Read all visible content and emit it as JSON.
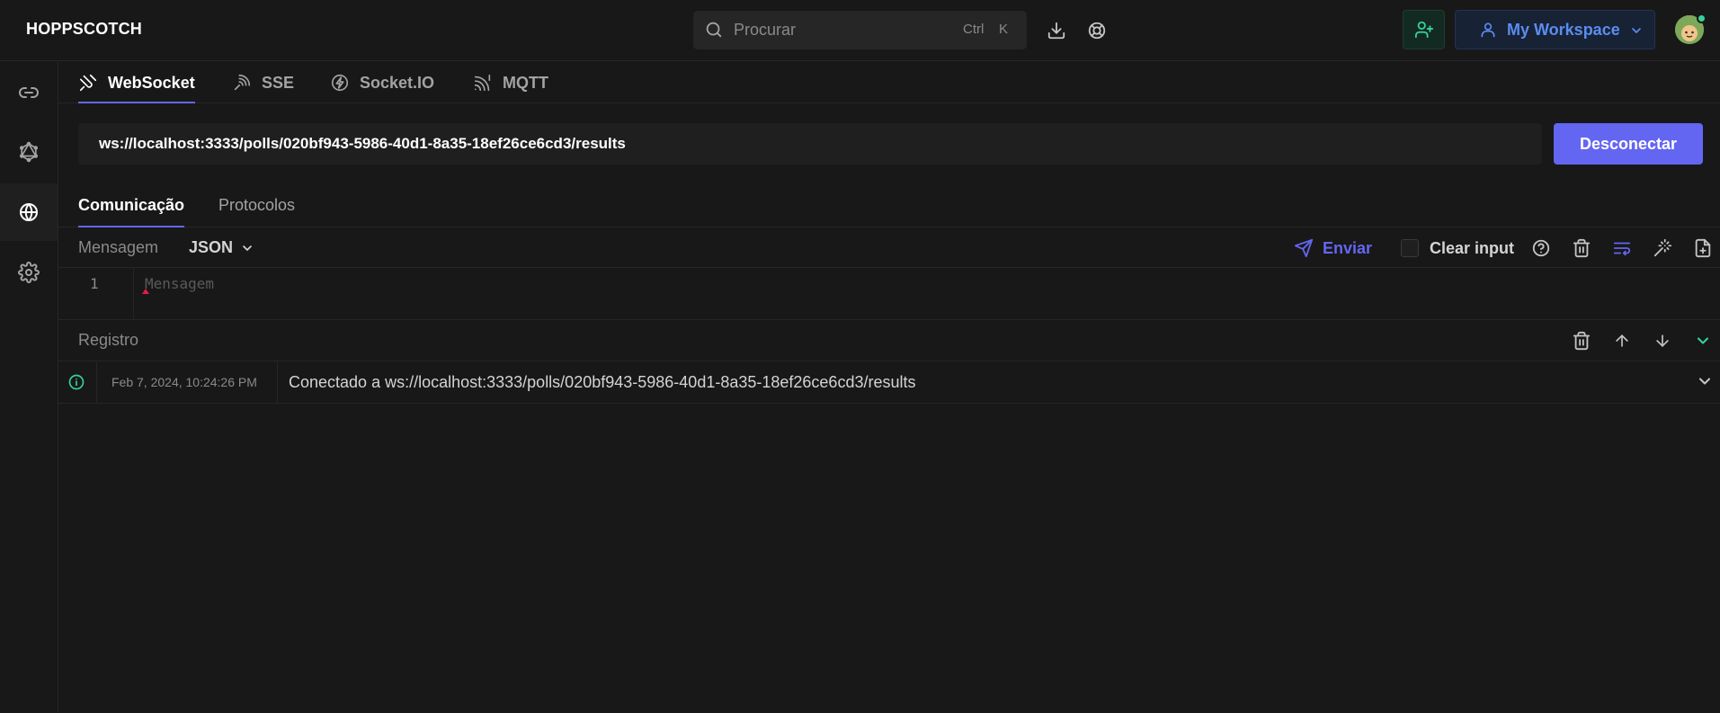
{
  "app": {
    "brand": "HOPPSCOTCH"
  },
  "header": {
    "search_placeholder": "Procurar",
    "shortcut_ctrl": "Ctrl",
    "shortcut_key": "K",
    "workspace_label": "My Workspace"
  },
  "sidebar": {
    "items": [
      {
        "name": "rest",
        "icon": "link-icon"
      },
      {
        "name": "graphql",
        "icon": "graphql-icon"
      },
      {
        "name": "realtime",
        "icon": "globe-icon",
        "active": true
      },
      {
        "name": "settings",
        "icon": "gear-icon"
      }
    ]
  },
  "protocol_tabs": [
    {
      "label": "WebSocket",
      "active": true
    },
    {
      "label": "SSE"
    },
    {
      "label": "Socket.IO"
    },
    {
      "label": "MQTT"
    }
  ],
  "connection": {
    "url": "ws://localhost:3333/polls/020bf943-5986-40d1-8a35-18ef26ce6cd3/results",
    "disconnect_label": "Desconectar"
  },
  "sub_tabs": [
    {
      "label": "Comunicação",
      "active": true
    },
    {
      "label": "Protocolos"
    }
  ],
  "message": {
    "title": "Mensagem",
    "format": "JSON",
    "send_label": "Enviar",
    "clear_input_label": "Clear input",
    "line_number": "1",
    "editor_placeholder": "Mensagem"
  },
  "log": {
    "title": "Registro",
    "entries": [
      {
        "timestamp": "Feb 7, 2024, 10:24:26 PM",
        "message": "Conectado a ws://localhost:3333/polls/020bf943-5986-40d1-8a35-18ef26ce6cd3/results"
      }
    ]
  },
  "colors": {
    "accent": "#6366f1",
    "success": "#34d399",
    "workspace_blue": "#5b8def",
    "background": "#181818"
  }
}
